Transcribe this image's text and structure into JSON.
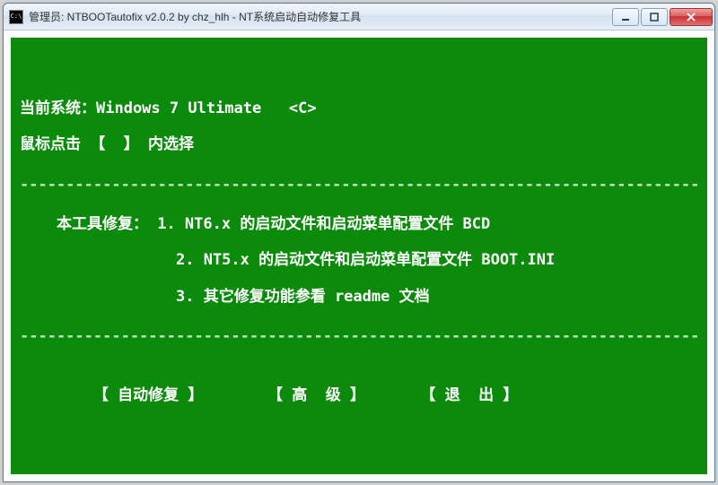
{
  "window": {
    "icon_label": "C:\\",
    "title": "管理员:  NTBOOTautofix v2.0.2 by chz_hlh - NT系统启动自动修复工具"
  },
  "console": {
    "current_system_label": "当前系统：",
    "current_system_value": "Windows 7 Ultimate   <C>",
    "click_hint": "鼠标点击 【  】 内选择",
    "separator": "---------------------------------------------------------------------------------------------",
    "fix_header": "    本工具修复：",
    "fix_lines": [
      "1. NT6.x 的启动文件和启动菜单配置文件 BCD",
      "2. NT5.x 的启动文件和启动菜单配置文件 BOOT.INI",
      "3. 其它修复功能参看 readme 文档"
    ],
    "menu": {
      "auto_fix": "【 自动修复 】",
      "advanced": "【 高  级 】",
      "exit": "【 退  出 】"
    }
  }
}
